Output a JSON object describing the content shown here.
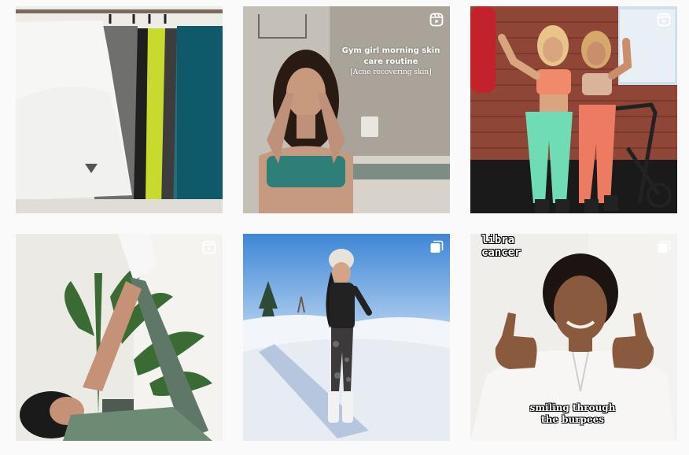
{
  "feed": {
    "posts": [
      {
        "alt_type": "image",
        "badge": ""
      },
      {
        "alt_type": "reel",
        "badge": "reel-icon",
        "caption_title": "Gym girl morning skin care routine",
        "caption_sub": "[Acne recovering skin]"
      },
      {
        "alt_type": "reel",
        "badge": "reel-icon"
      },
      {
        "alt_type": "reel",
        "badge": "reel-icon"
      },
      {
        "alt_type": "carousel",
        "badge": "carousel-icon"
      },
      {
        "alt_type": "carousel",
        "badge": "carousel-icon",
        "caption_top": "libra\ncancer",
        "caption_bottom": "smiling through\nthe burpees"
      }
    ]
  },
  "colors": {
    "page_bg": "#fafafa"
  }
}
